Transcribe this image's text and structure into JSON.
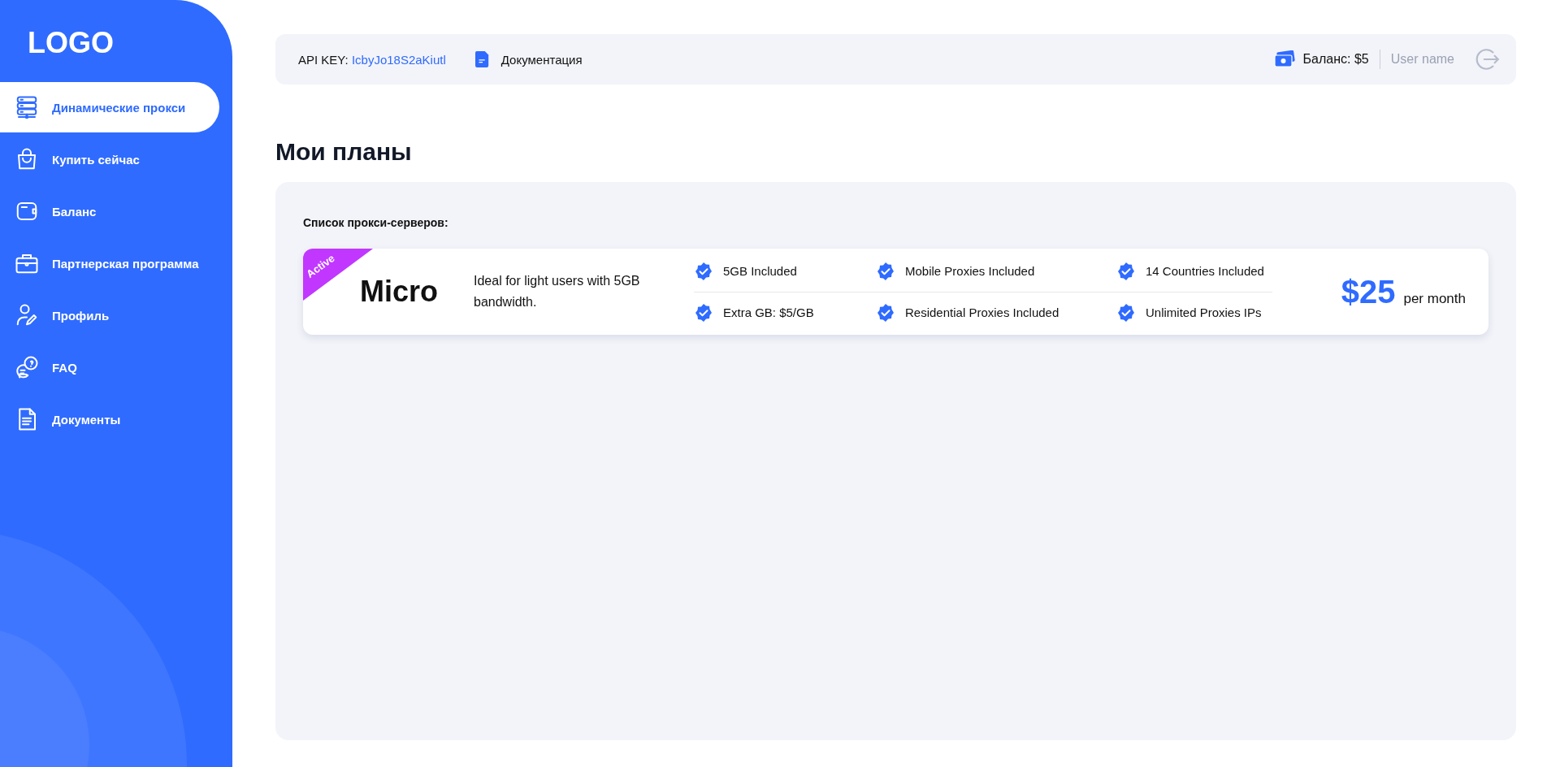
{
  "sidebar": {
    "logo": "LOGO",
    "items": [
      {
        "label": "Динамические прокси",
        "selected": true
      },
      {
        "label": "Купить сейчас",
        "selected": false
      },
      {
        "label": "Баланс",
        "selected": false
      },
      {
        "label": "Партнерская программа",
        "selected": false
      },
      {
        "label": "Профиль",
        "selected": false
      },
      {
        "label": "FAQ",
        "selected": false
      },
      {
        "label": "Документы",
        "selected": false
      }
    ]
  },
  "header": {
    "api_key_label": "API KEY:",
    "api_key": "IcbyJo18S2aKiutl",
    "docs_link": "Документация",
    "balance": "Баланс: $5",
    "user_name": "User name"
  },
  "page_title": "Мои планы",
  "panel": {
    "title": "Список прокси-серверов:",
    "plans": [
      {
        "badge": "Active",
        "name": "Micro",
        "description": "Ideal for light users with 5GB bandwidth.",
        "features": [
          [
            "5GB Included",
            "Mobile Proxies Included",
            "14 Countries Included"
          ],
          [
            "Extra GB: $5/GB",
            "Residential Proxies Included",
            "Unlimited Proxies IPs"
          ]
        ],
        "price": "$25",
        "period": "per month"
      }
    ]
  }
}
